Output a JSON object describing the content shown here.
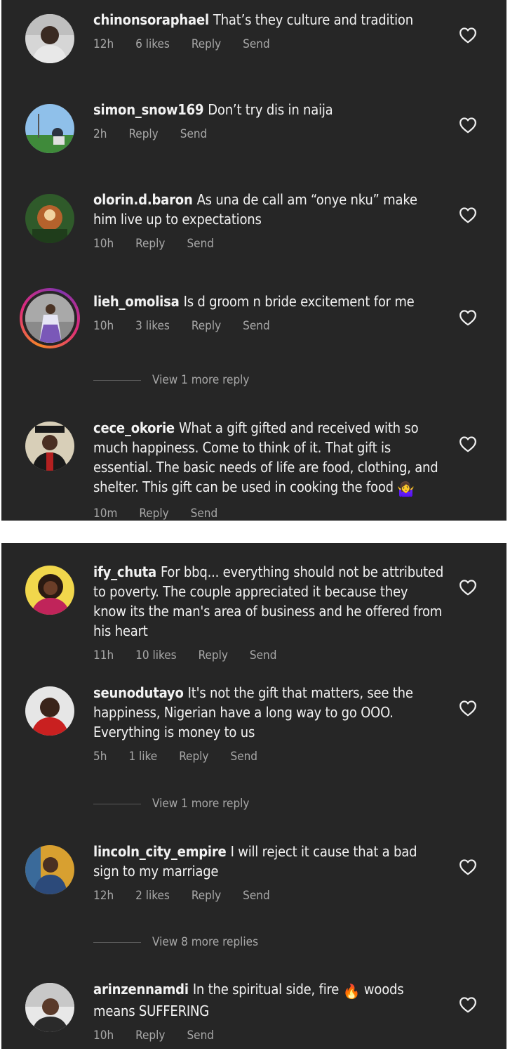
{
  "panel1": {
    "comments": [
      {
        "username": "chinonsoraphael",
        "text": "That’s they culture and tradition",
        "time": "12h",
        "likes": "6 likes",
        "reply": "Reply",
        "send": "Send"
      },
      {
        "username": "simon_snow169",
        "text": "Don’t try dis in naija",
        "time": "2h",
        "reply": "Reply",
        "send": "Send"
      },
      {
        "username": "olorin.d.baron",
        "text": "As una de call am “onye nku” make him live up to expectations",
        "time": "10h",
        "reply": "Reply",
        "send": "Send"
      },
      {
        "username": "lieh_omolisa",
        "text": "Is d groom n bride excitement for me",
        "time": "10h",
        "likes": "3 likes",
        "reply": "Reply",
        "send": "Send",
        "view_more": "View 1 more reply"
      },
      {
        "username": "cece_okorie",
        "text": "What a gift gifted and received with so much happiness. Come to think of it. That gift is essential. The basic needs of life are food, clothing, and shelter. This gift can be used in cooking the food",
        "emoji": "🤷‍♀️",
        "time": "10m",
        "reply": "Reply",
        "send": "Send"
      }
    ]
  },
  "panel2": {
    "comments": [
      {
        "username": "ify_chuta",
        "text": "For bbq... everything should not be attributed to poverty. The couple appreciated it because they know its the man's area of business and he offered from his heart",
        "time": "11h",
        "likes": "10 likes",
        "reply": "Reply",
        "send": "Send"
      },
      {
        "username": "seunodutayo",
        "text": "It's not the gift that matters, see the happiness, Nigerian have a long way to go OOO. Everything is money to us",
        "time": "5h",
        "likes": "1 like",
        "reply": "Reply",
        "send": "Send",
        "view_more": "View 1 more reply"
      },
      {
        "username": "lincoln_city_empire",
        "text": "I will reject it cause that a bad sign to my marriage",
        "time": "12h",
        "likes": "2 likes",
        "reply": "Reply",
        "send": "Send",
        "view_more": "View 8 more replies"
      },
      {
        "username": "arinzennamdi",
        "text_before": "In the spiritual side, fire",
        "emoji": "🔥",
        "text_after": "woods means SUFFERING",
        "time": "10h",
        "reply": "Reply",
        "send": "Send"
      }
    ]
  },
  "icons": {
    "like": "heart-outline-icon"
  },
  "colors": {
    "background": "#262626",
    "text": "#f2f2f2",
    "muted": "#a8a8a8"
  }
}
